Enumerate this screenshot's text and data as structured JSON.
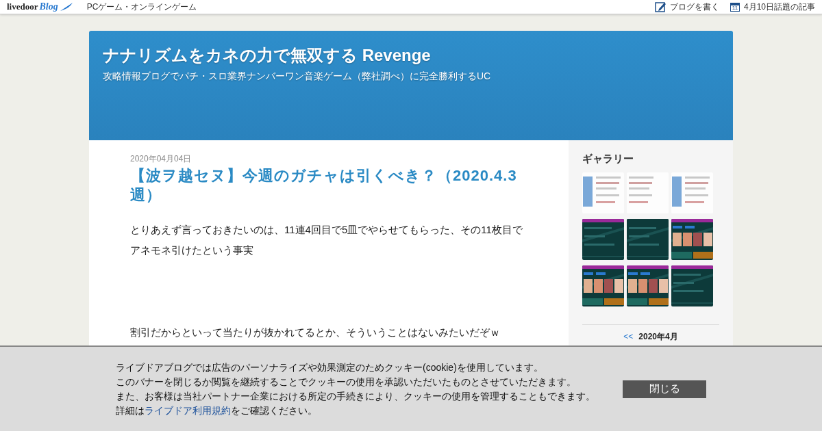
{
  "topbar": {
    "logo": {
      "brand": "livedoor",
      "product": "Blog"
    },
    "category": "PCゲーム・オンラインゲーム",
    "write_link": "ブログを書く",
    "calendar_day": "11",
    "topic_link": "4月10日話題の記事"
  },
  "header": {
    "title": "ナナリズムをカネの力で無双する Revenge",
    "subtitle": "攻略情報ブログでパチ・スロ業界ナンバーワン音楽ゲーム（弊社調べ）に完全勝利するUC"
  },
  "article": {
    "date": "2020年04月04日",
    "title": "【波ヲ越セヌ】今週のガチャは引くべき？（2020.4.3週）",
    "paragraphs": [
      "とりあえず言っておきたいのは、11連4回目で5皿でやらせてもらった、その11枚目でアネモネ引けたという事実",
      "割引だからといって当たりが抜かれてるとか、そういうことはないみたいだぞｗ"
    ]
  },
  "sidebar": {
    "gallery_title": "ギャラリー",
    "calendar": {
      "prev": "<<",
      "month": "2020年4月"
    }
  },
  "cookie_banner": {
    "lines": [
      "ライブドアブログでは広告のパーソナライズや効果測定のためクッキー(cookie)を使用しています。",
      "このバナーを閉じるか閲覧を継続することでクッキーの使用を承認いただいたものとさせていただきます。",
      "また、お客様は当社パートナー企業における所定の手続きにより、クッキーの使用を管理することもできます。"
    ],
    "detail_prefix": "詳細は",
    "detail_link": "ライブドア利用規約",
    "detail_suffix": "をご確認ください。",
    "close_button": "閉じる"
  }
}
